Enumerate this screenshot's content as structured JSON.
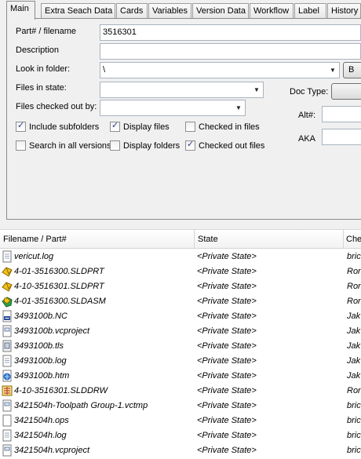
{
  "tabs": [
    "Main",
    "Extra Seach Data",
    "Cards",
    "Variables",
    "Version Data",
    "Workflow",
    "Label",
    "History"
  ],
  "form": {
    "part_label": "Part# / filename",
    "part_value": "3516301",
    "description_label": "Description",
    "description_value": "",
    "folder_label": "Look in folder:",
    "folder_value": "\\",
    "folder_button": "B",
    "state_label": "Files in state:",
    "state_value": "",
    "checked_out_label": "Files checked out by:",
    "checked_out_value": "",
    "doctype_label": "Doc Type:",
    "alt_label": "Alt#:",
    "alt_value": "",
    "aka_label": "AKA",
    "aka_value": ""
  },
  "checkboxes": [
    {
      "label": "Include subfolders",
      "checked": true
    },
    {
      "label": "Display files",
      "checked": true
    },
    {
      "label": "Checked in files",
      "checked": false
    },
    {
      "label": "Search in all versions",
      "checked": false
    },
    {
      "label": "Display folders",
      "checked": false
    },
    {
      "label": "Checked out files",
      "checked": true
    }
  ],
  "columns": [
    "Filename / Part#",
    "State",
    "Che"
  ],
  "rows": [
    {
      "icon": "text-file-icon",
      "name": "vericut.log",
      "state": "<Private State>",
      "by": "bric"
    },
    {
      "icon": "solidworks-part-icon",
      "name": "4-01-3516300.SLDPRT",
      "state": "<Private State>",
      "by": "Ron"
    },
    {
      "icon": "solidworks-part-icon",
      "name": "4-10-3516301.SLDPRT",
      "state": "<Private State>",
      "by": "Ron"
    },
    {
      "icon": "solidworks-assembly-icon",
      "name": "4-01-3516300.SLDASM",
      "state": "<Private State>",
      "by": "Ron"
    },
    {
      "icon": "nc-file-icon",
      "name": "3493100b.NC",
      "state": "<Private State>",
      "by": "Jak"
    },
    {
      "icon": "project-file-icon",
      "name": "3493100b.vcproject",
      "state": "<Private State>",
      "by": "Jak"
    },
    {
      "icon": "tool-file-icon",
      "name": "3493100b.tls",
      "state": "<Private State>",
      "by": "Jak"
    },
    {
      "icon": "text-file-icon",
      "name": "3493100b.log",
      "state": "<Private State>",
      "by": "Jak"
    },
    {
      "icon": "html-file-icon",
      "name": "3493100b.htm",
      "state": "<Private State>",
      "by": "Jak"
    },
    {
      "icon": "solidworks-drawing-icon",
      "name": "4-10-3516301.SLDDRW",
      "state": "<Private State>",
      "by": "Ron"
    },
    {
      "icon": "project-file-icon",
      "name": "3421504h-Toolpath Group-1.vctmp",
      "state": "<Private State>",
      "by": "bric"
    },
    {
      "icon": "blank-file-icon",
      "name": "3421504h.ops",
      "state": "<Private State>",
      "by": "bric"
    },
    {
      "icon": "text-file-icon",
      "name": "3421504h.log",
      "state": "<Private State>",
      "by": "bric"
    },
    {
      "icon": "project-file-icon",
      "name": "3421504h.vcproject",
      "state": "<Private State>",
      "by": "bric"
    }
  ]
}
